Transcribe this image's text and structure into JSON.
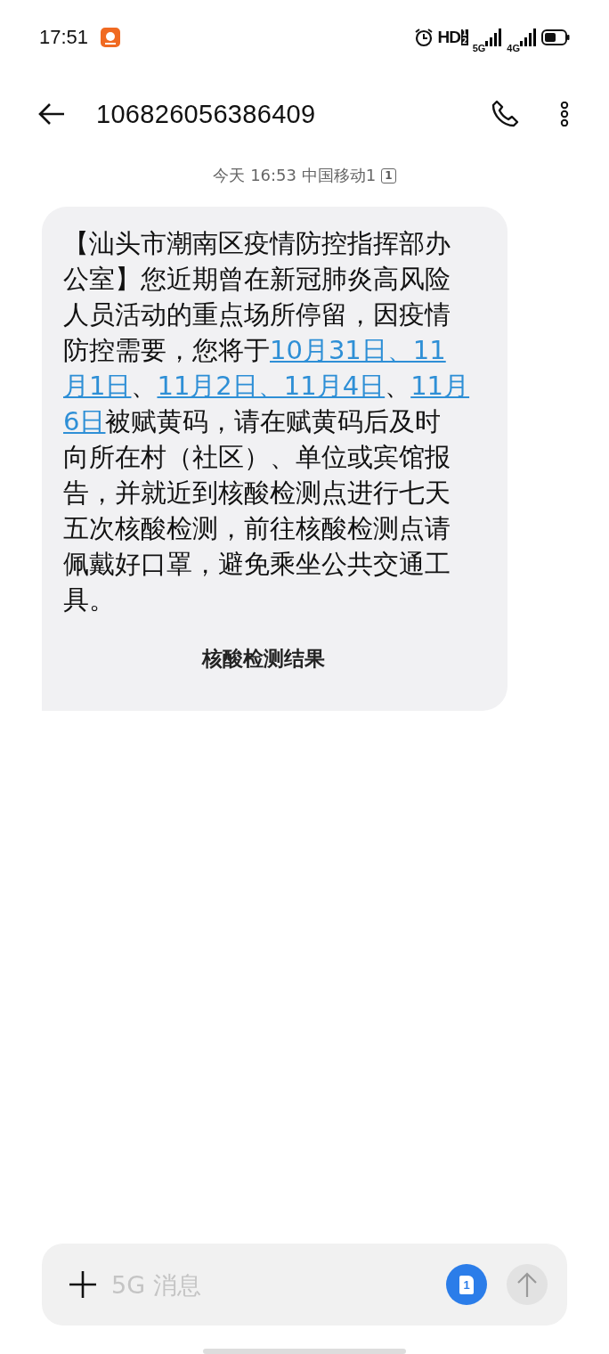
{
  "status_bar": {
    "time": "17:51",
    "hd": "HD",
    "hd_slots": [
      "1",
      "2"
    ],
    "network_1": "5G",
    "network_2": "4G"
  },
  "header": {
    "title": "106826056386409"
  },
  "timestamp": {
    "text": "今天 16:53 中国移动1",
    "sim": "1"
  },
  "message": {
    "lines": [
      [
        {
          "kind": "text",
          "text": "【汕头市潮南区疫情防控指挥部办"
        }
      ],
      [
        {
          "kind": "text",
          "text": "公室】您近期曾在新冠肺炎高风险"
        }
      ],
      [
        {
          "kind": "text",
          "text": "人员活动的重点场所停留，因疫情"
        }
      ],
      [
        {
          "kind": "text",
          "text": "防控需要，您将于"
        },
        {
          "kind": "link",
          "text": "10月31日、11"
        }
      ],
      [
        {
          "kind": "link",
          "text": "月1日"
        },
        {
          "kind": "text",
          "text": "、"
        },
        {
          "kind": "link",
          "text": "11月2日、11月4日"
        },
        {
          "kind": "text",
          "text": "、"
        },
        {
          "kind": "link",
          "text": "11月"
        }
      ],
      [
        {
          "kind": "link",
          "text": "6日"
        },
        {
          "kind": "text",
          "text": "被赋黄码，请在赋黄码后及时"
        }
      ],
      [
        {
          "kind": "text",
          "text": "向所在村（社区）、单位或宾馆报"
        }
      ],
      [
        {
          "kind": "text",
          "text": "告，并就近到核酸检测点进行七天"
        }
      ],
      [
        {
          "kind": "text",
          "text": "五次核酸检测，前往核酸检测点请"
        }
      ],
      [
        {
          "kind": "text",
          "text": "佩戴好口罩，避免乘坐公共交通工"
        }
      ],
      [
        {
          "kind": "text",
          "text": "具。"
        }
      ]
    ],
    "action": "核酸检测结果"
  },
  "composer": {
    "placeholder": "5G 消息",
    "sim": "1"
  }
}
